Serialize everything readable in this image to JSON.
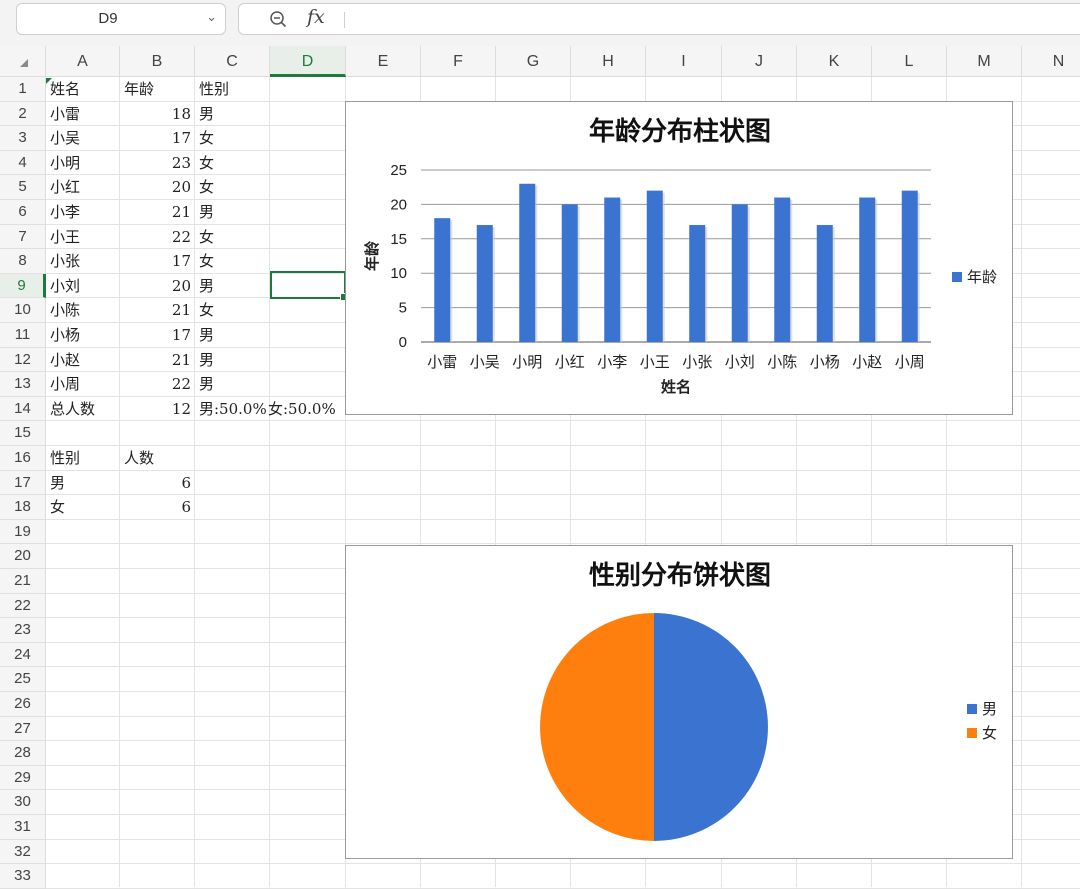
{
  "formula_bar": {
    "name_box": "D9",
    "name_box_chevron": "chevron-down-icon",
    "zoom_icon": "zoom-out-icon",
    "fx_label": "fx",
    "formula": ""
  },
  "columns": [
    "A",
    "B",
    "C",
    "D",
    "E",
    "F",
    "G",
    "H",
    "I",
    "J",
    "K",
    "L",
    "M",
    "N"
  ],
  "rows": [
    "1",
    "2",
    "3",
    "4",
    "5",
    "6",
    "7",
    "8",
    "9",
    "10",
    "11",
    "12",
    "13",
    "14",
    "15",
    "16",
    "17",
    "18",
    "19",
    "20",
    "21",
    "22",
    "23",
    "24",
    "25",
    "26",
    "27",
    "28",
    "29",
    "30",
    "31",
    "32",
    "33"
  ],
  "selected_cell": {
    "column": "D",
    "row": "9"
  },
  "sheet": {
    "header": {
      "name": "姓名",
      "age": "年龄",
      "gender": "性别"
    },
    "people": [
      {
        "name": "小雷",
        "age": "18",
        "gender": "男"
      },
      {
        "name": "小吴",
        "age": "17",
        "gender": "女"
      },
      {
        "name": "小明",
        "age": "23",
        "gender": "女"
      },
      {
        "name": "小红",
        "age": "20",
        "gender": "女"
      },
      {
        "name": "小李",
        "age": "21",
        "gender": "男"
      },
      {
        "name": "小王",
        "age": "22",
        "gender": "女"
      },
      {
        "name": "小张",
        "age": "17",
        "gender": "女"
      },
      {
        "name": "小刘",
        "age": "20",
        "gender": "男"
      },
      {
        "name": "小陈",
        "age": "21",
        "gender": "女"
      },
      {
        "name": "小杨",
        "age": "17",
        "gender": "男"
      },
      {
        "name": "小赵",
        "age": "21",
        "gender": "男"
      },
      {
        "name": "小周",
        "age": "22",
        "gender": "男"
      }
    ],
    "total": {
      "label": "总人数",
      "count": "12",
      "male_pct": "男:50.0%",
      "female_pct": "女:50.0%"
    },
    "summary_header": {
      "gender": "性别",
      "count": "人数"
    },
    "summary": [
      {
        "gender": "男",
        "count": "6"
      },
      {
        "gender": "女",
        "count": "6"
      }
    ]
  },
  "colors": {
    "blue": "#3a74d0",
    "orange": "#ff7f0e",
    "selection_green": "#1e7a3c"
  },
  "chart_data": [
    {
      "type": "bar",
      "title": "年龄分布柱状图",
      "xlabel": "姓名",
      "ylabel": "年龄",
      "categories": [
        "小雷",
        "小吴",
        "小明",
        "小红",
        "小李",
        "小王",
        "小张",
        "小刘",
        "小陈",
        "小杨",
        "小赵",
        "小周"
      ],
      "series": [
        {
          "name": "年龄",
          "values": [
            18,
            17,
            23,
            20,
            21,
            22,
            17,
            20,
            21,
            17,
            21,
            22
          ],
          "color": "#3a74d0"
        }
      ],
      "ylim": [
        0,
        25
      ],
      "yticks": [
        "0",
        "5",
        "10",
        "15",
        "20",
        "25"
      ],
      "grid": true,
      "legend": "right"
    },
    {
      "type": "pie",
      "title": "性别分布饼状图",
      "labels": [
        "男",
        "女"
      ],
      "values": [
        6,
        6
      ],
      "colors": [
        "#3a74d0",
        "#ff7f0e"
      ],
      "legend": "right"
    }
  ]
}
